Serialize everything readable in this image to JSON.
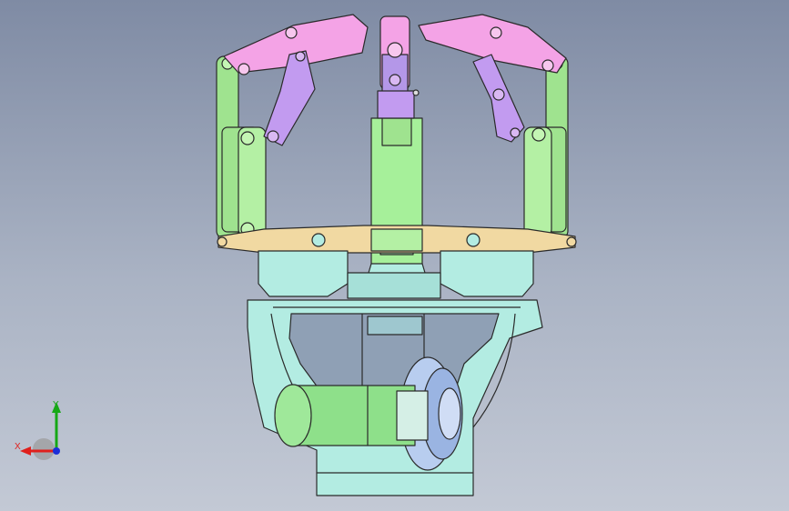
{
  "viewport": {
    "background_top": "#7f8ba4",
    "background_bottom": "#c3c9d5",
    "part_colors": {
      "finger_tip": "#f4a3e6",
      "finger_link": "#c29bf0",
      "side_arm": "#9fe38f",
      "crossbar": "#f1d9a2",
      "base": "#b3ece2",
      "motor": "#8ee08a",
      "pulley": "#b8cdef",
      "center_column": "#a6f09a"
    }
  },
  "triad": {
    "x_label": "X",
    "y_label": "Y",
    "x_color": "#e0201c",
    "y_color": "#16a816",
    "z_color": "#1c2fd8",
    "origin_color": "#9a9a9a"
  }
}
